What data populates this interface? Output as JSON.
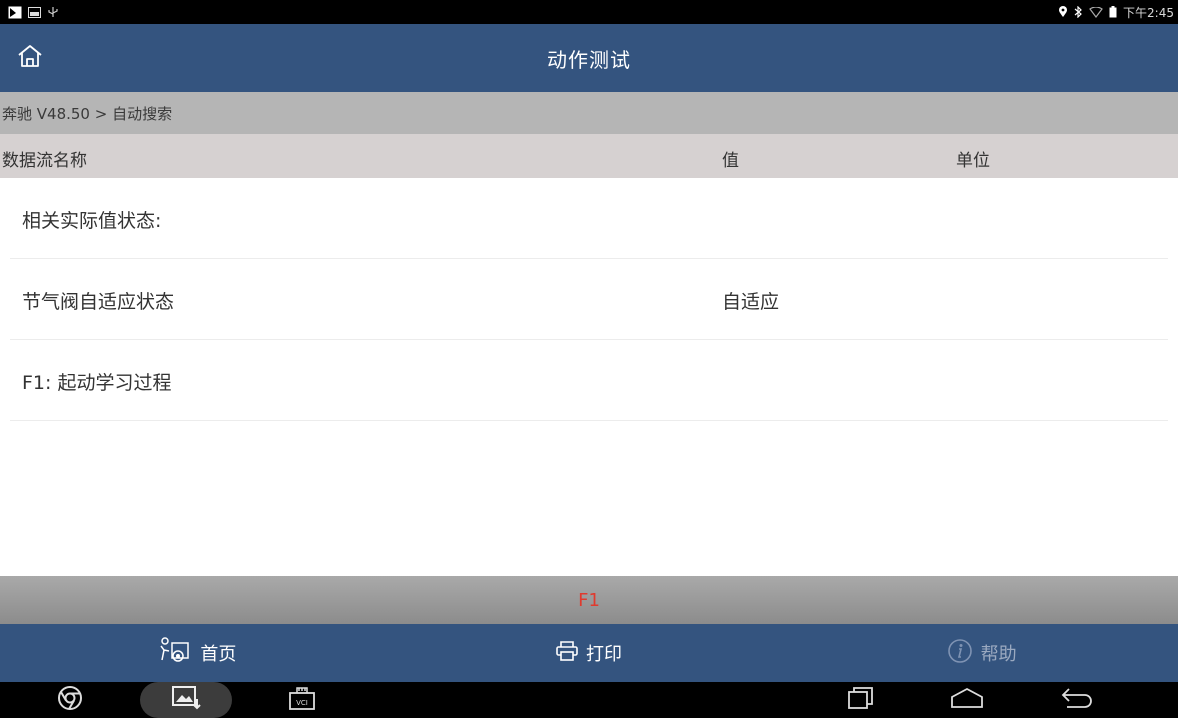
{
  "status_bar": {
    "time": "下午2:45"
  },
  "header": {
    "title": "动作测试"
  },
  "breadcrumb": "奔驰 V48.50 > 自动搜索",
  "columns": {
    "name": "数据流名称",
    "value": "值",
    "unit": "单位"
  },
  "rows": [
    {
      "name": "相关实际值状态:",
      "value": "",
      "unit": ""
    },
    {
      "name": "节气阀自适应状态",
      "value": "自适应",
      "unit": ""
    },
    {
      "name": "F1: 起动学习过程",
      "value": "",
      "unit": ""
    }
  ],
  "function_key": {
    "label": "F1"
  },
  "toolbar": {
    "home_label": "首页",
    "print_label": "打印",
    "help_label": "帮助"
  },
  "colors": {
    "header_bg": "#34547f",
    "fkey_text": "#e03a2e",
    "breadcrumb_bg": "#b5b5b5",
    "column_header_bg": "#d6d1d1"
  },
  "icons": {
    "status_left": [
      "notification-icon",
      "image-notification-icon",
      "usb-icon"
    ],
    "status_right": [
      "location-icon",
      "bluetooth-icon",
      "wifi-icon",
      "battery-icon"
    ],
    "nav": [
      "chrome-icon",
      "gallery-icon",
      "vci-icon",
      "recent-apps-icon",
      "home-nav-icon",
      "back-icon"
    ]
  }
}
